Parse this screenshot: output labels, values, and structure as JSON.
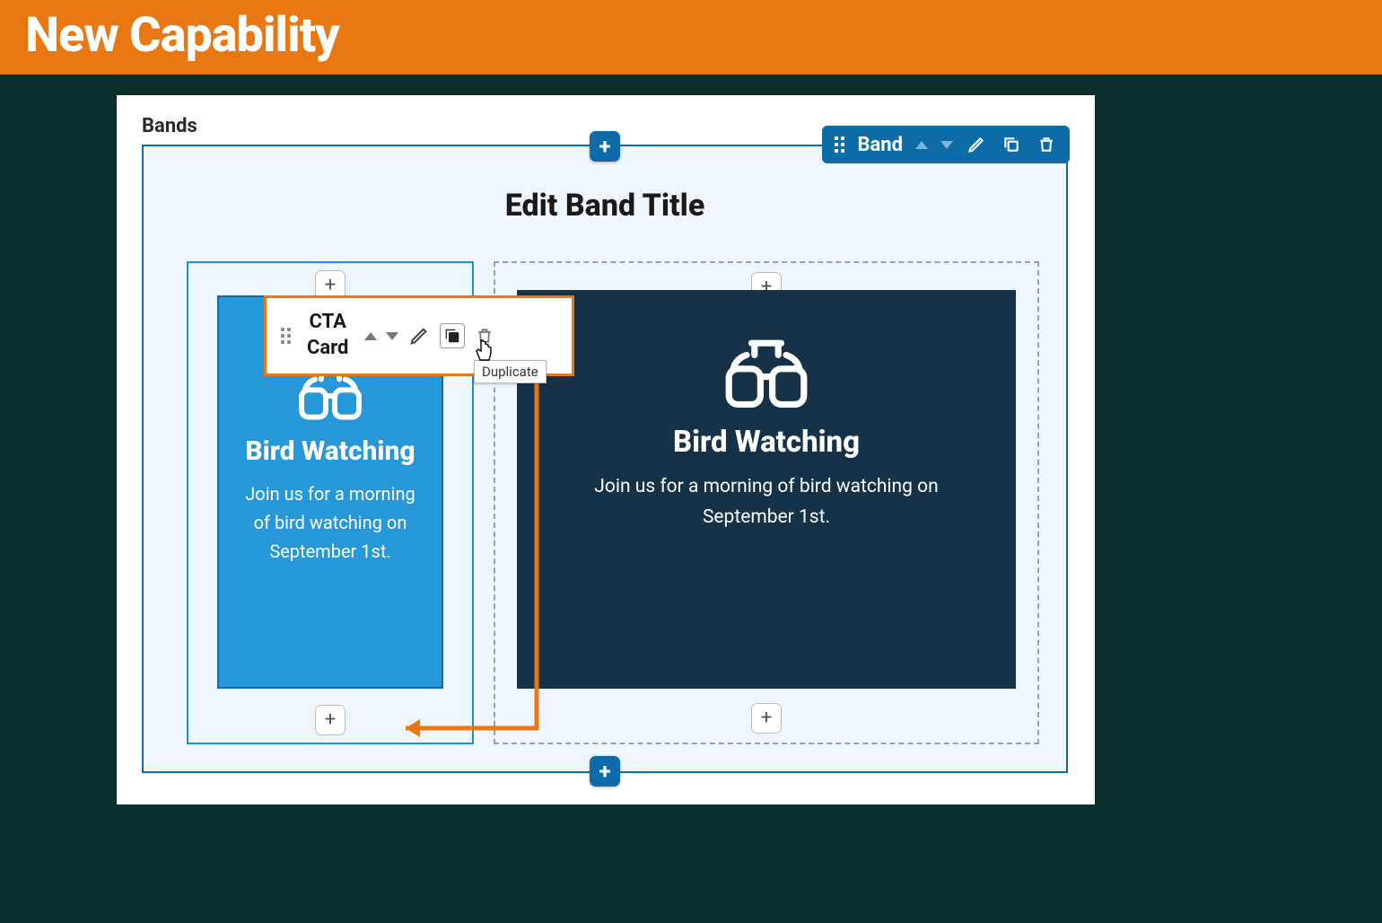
{
  "banner": {
    "title": "New Capability"
  },
  "editor": {
    "section_label": "Bands",
    "band_toolbar_label": "Band",
    "band_title": "Edit Band Title"
  },
  "cta_toolbar": {
    "label_line1": "CTA",
    "label_line2": "Card",
    "tooltip": "Duplicate"
  },
  "cards": {
    "left": {
      "heading": "Bird Watching",
      "body": "Join us for a morning of bird watching on September 1st."
    },
    "right": {
      "heading": "Bird Watching",
      "body": "Join us for a morning of bird watching on September 1st."
    }
  },
  "colors": {
    "accent_orange": "#e97813",
    "brand_blue": "#0d6ca8",
    "card_blue": "#2697d8",
    "dark_navy": "#163249",
    "page_bg": "#0a2e2a"
  }
}
